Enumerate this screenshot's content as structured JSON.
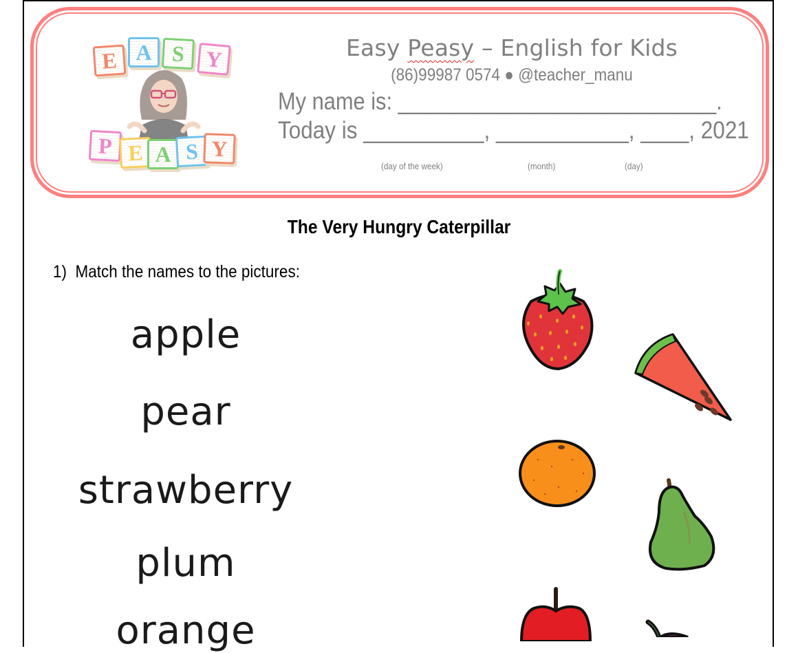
{
  "header": {
    "logo": {
      "top_word": [
        "E",
        "A",
        "S",
        "Y"
      ],
      "bottom_word": [
        "P",
        "E",
        "A",
        "S",
        "Y"
      ],
      "top_colors": [
        "#f2876a",
        "#6ec3ee",
        "#7fcf73",
        "#ef86c8"
      ],
      "bottom_colors": [
        "#ef86c8",
        "#f7cf5c",
        "#7fcf73",
        "#6ec3ee",
        "#f2876a"
      ],
      "image": "teacher-avatar"
    },
    "brand_title_pre": "Easy ",
    "brand_title_flagged": "Peasy",
    "brand_title_post": " – English for Kids",
    "contact": "(86)99987 0574 ● @teacher_manu",
    "name_prompt": "My name is: ___________________________.",
    "date_prompt": "Today is __________, ___________, ____, 2021",
    "date_hints": {
      "weekday": "(day of the week)",
      "month": "(month)",
      "day": "(day)"
    },
    "accent_color": "#ff7f7f"
  },
  "worksheet": {
    "title": "The Very Hungry Caterpillar",
    "question_number": "1)",
    "instruction": "Match the names to the pictures:",
    "words": [
      "apple",
      "pear",
      "strawberry",
      "plum",
      "orange"
    ],
    "pictures": [
      "strawberry",
      "watermelon",
      "orange",
      "pear",
      "apple",
      "plum"
    ]
  }
}
